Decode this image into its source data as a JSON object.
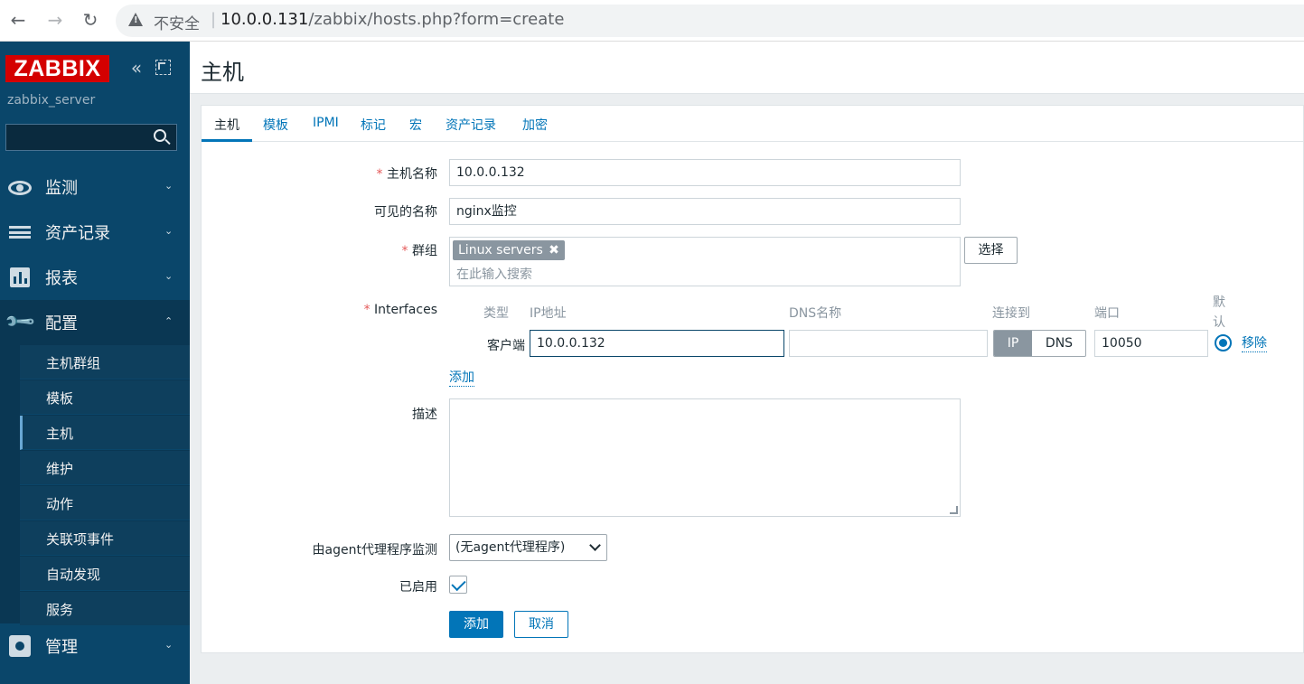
{
  "browser": {
    "insecure_label": "不安全",
    "separator": "|",
    "url_host": "10.0.0.131",
    "url_path": "/zabbix/hosts.php?form=create"
  },
  "sidebar": {
    "logo": "ZABBIX",
    "server_name": "zabbix_server",
    "menu": {
      "monitoring": "监测",
      "inventory": "资产记录",
      "reports": "报表",
      "configuration": "配置",
      "administration": "管理"
    },
    "submenu": [
      "主机群组",
      "模板",
      "主机",
      "维护",
      "动作",
      "关联项事件",
      "自动发现",
      "服务"
    ]
  },
  "header": {
    "title": "主机"
  },
  "tabs": [
    "主机",
    "模板",
    "IPMI",
    "标记",
    "宏",
    "资产记录",
    "加密"
  ],
  "form": {
    "required_mark": "*",
    "host_name_label": "主机名称",
    "host_name_value": "10.0.0.132",
    "visible_name_label": "可见的名称",
    "visible_name_value": "nginx监控",
    "groups_label": "群组",
    "group_chip": "Linux servers",
    "chip_remove": "✖",
    "groups_placeholder": "在此输入搜索",
    "select_button": "选择",
    "interfaces_label": "Interfaces",
    "iface_headers": {
      "type": "类型",
      "ip": "IP地址",
      "dns": "DNS名称",
      "connect": "连接到",
      "port": "端口",
      "default_1": "默",
      "default_2": "认"
    },
    "iface_row": {
      "type": "客户端",
      "ip": "10.0.0.132",
      "dns": "",
      "connect_ip": "IP",
      "connect_dns": "DNS",
      "port": "10050",
      "remove": "移除"
    },
    "add_link": "添加",
    "description_label": "描述",
    "proxy_label": "由agent代理程序监测",
    "proxy_value": "(无agent代理程序)",
    "enabled_label": "已启用",
    "add_button": "添加",
    "cancel_button": "取消"
  },
  "colors": {
    "sidebar_bg": "#0a466a",
    "accent": "#0275b8",
    "logo_red": "#d40000",
    "required": "#e45959"
  }
}
